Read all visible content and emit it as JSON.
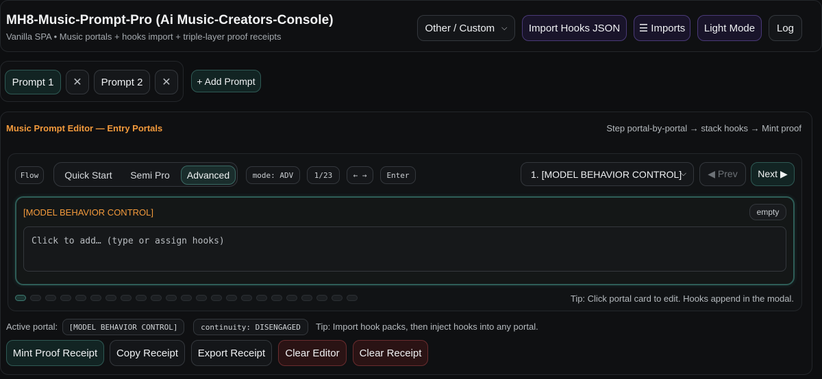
{
  "header": {
    "title": "MH8-Music-Prompt-Pro (Ai Music-Creators-Console)",
    "subtitle": "Vanilla SPA • Music portals + hooks import + triple-layer proof receipts",
    "platform_select": "Other / Custom",
    "import_hooks": "Import Hooks JSON",
    "imports": "☰ Imports",
    "theme_toggle": "Light Mode",
    "log": "Log"
  },
  "prompts": {
    "tabs": [
      {
        "label": "Prompt 1",
        "close": "✕"
      },
      {
        "label": "Prompt 2",
        "close": "✕"
      }
    ],
    "add": "+ Add Prompt"
  },
  "editor": {
    "title": "Music Prompt Editor — Entry Portals",
    "hint": "Step portal-by-portal → stack hooks → Mint proof",
    "flow_label": "Flow",
    "modes": [
      "Quick Start",
      "Semi Pro",
      "Advanced"
    ],
    "active_mode": "Advanced",
    "mode_badge": "mode: ADV",
    "progress": "1/23",
    "arrows": "← →",
    "enter": "Enter",
    "portal_select": "1. [MODEL BEHAVIOR CONTROL]",
    "prev": "◀ Prev",
    "next": "Next ▶",
    "portal": {
      "name": "[MODEL BEHAVIOR CONTROL]",
      "status": "empty",
      "placeholder": "Click to add… (type or assign hooks)"
    },
    "portal_count": 23,
    "current_portal_index": 1,
    "tip": "Tip: Click portal card to edit. Hooks append in the modal."
  },
  "status_row": {
    "label": "Active portal:",
    "portal": "[MODEL BEHAVIOR CONTROL]",
    "continuity": "continuity: DISENGAGED",
    "tip": "Tip: Import hook packs, then inject hooks into any portal."
  },
  "actions": {
    "mint": "Mint Proof Receipt",
    "copy": "Copy Receipt",
    "export": "Export Receipt",
    "clear_editor": "Clear Editor",
    "clear_receipt": "Clear Receipt"
  },
  "colors": {
    "accent_orange": "#f39a3c",
    "teal": "#2f5a55",
    "purple": "#4a3a78",
    "danger": "#6a2c2e"
  }
}
